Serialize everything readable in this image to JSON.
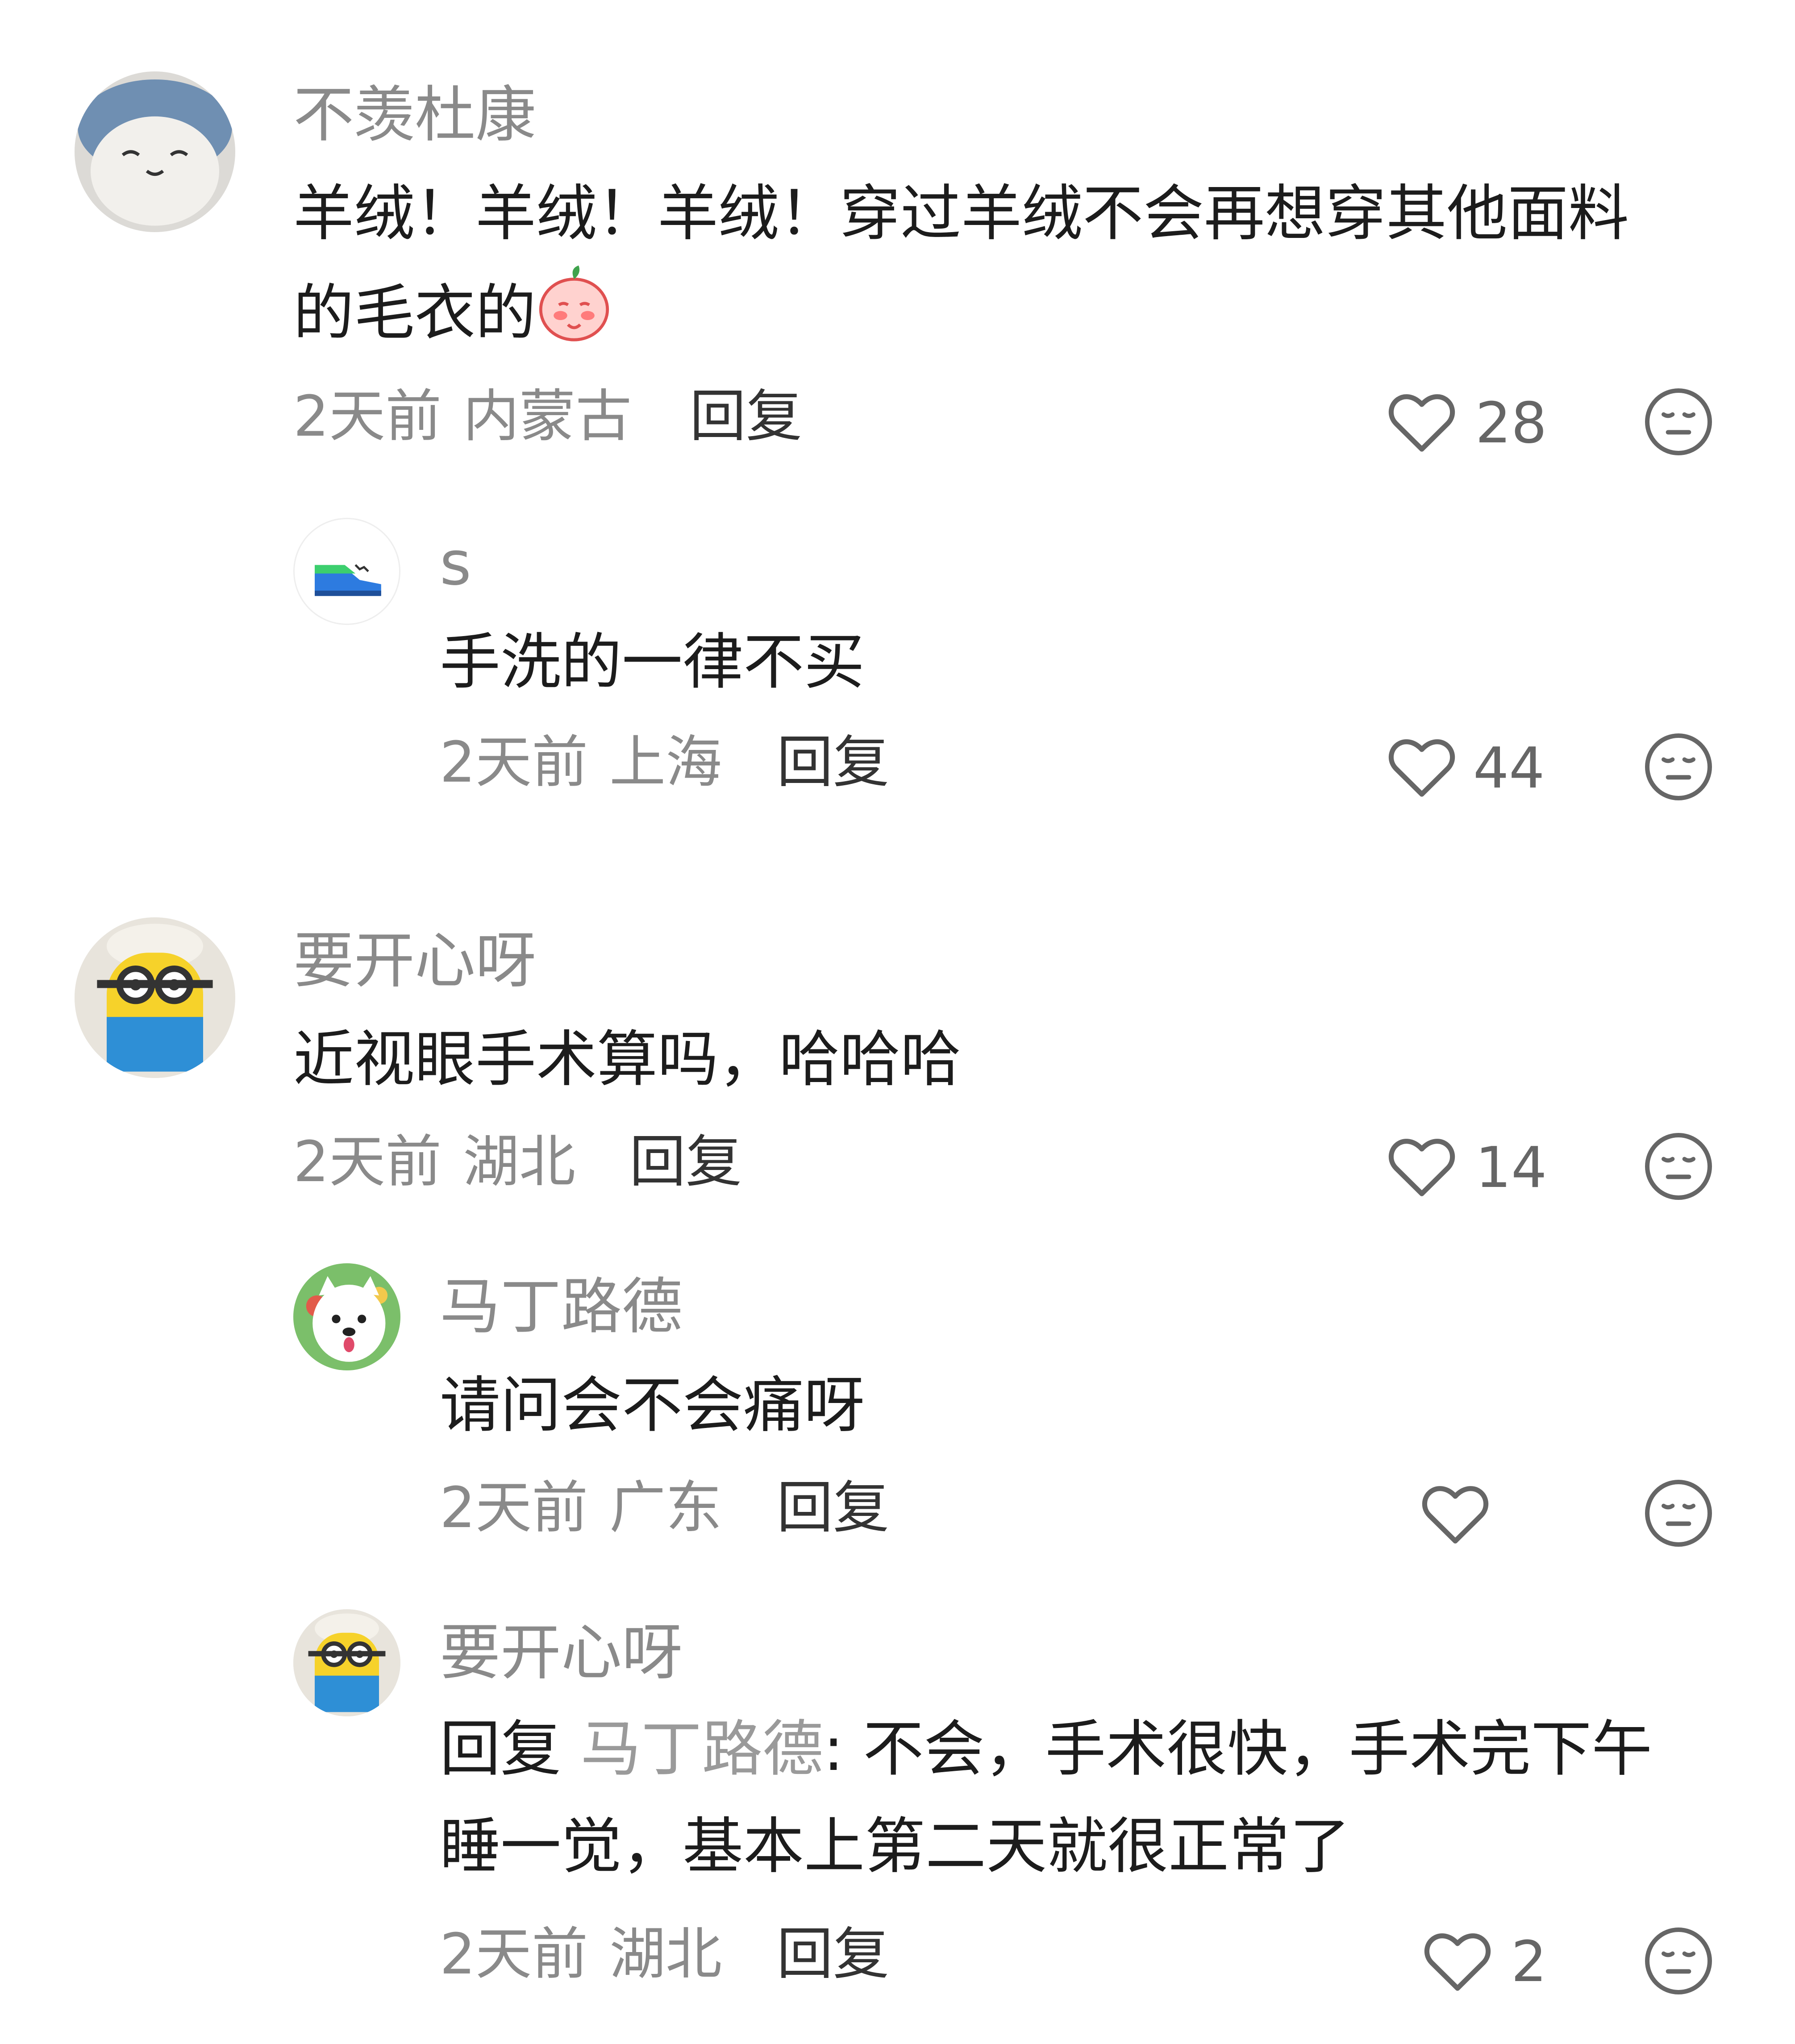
{
  "comments": [
    {
      "username": "不羡杜康",
      "content_line1": "羊绒！羊绒！羊绒！穿过羊绒不会再想穿其他面料",
      "content_line2": "的毛衣的",
      "time": "2天前",
      "location": "内蒙古",
      "reply_label": "回复",
      "likes": "28",
      "avatar_icon": "fluffy-plush-avatar"
    },
    {
      "username": "s",
      "content_line1": "手洗的一律不买",
      "time": "2天前",
      "location": "上海",
      "reply_label": "回复",
      "likes": "44",
      "avatar_icon": "sneaker-avatar"
    },
    {
      "username": "要开心呀",
      "content_line1": "近视眼手术算吗，哈哈哈",
      "time": "2天前",
      "location": "湖北",
      "reply_label": "回复",
      "likes": "14",
      "avatar_icon": "minion-avatar"
    },
    {
      "username": "马丁路德",
      "content_line1": "请问会不会痛呀",
      "time": "2天前",
      "location": "广东",
      "reply_label": "回复",
      "likes": "",
      "avatar_icon": "white-dog-avatar"
    },
    {
      "username": "要开心呀",
      "reply_prefix": "回复 ",
      "mention": "马丁路德",
      "content_line1_rest": ": 不会，手术很快，手术完下午",
      "content_line2": "睡一觉，基本上第二天就很正常了",
      "time": "2天前",
      "location": "湖北",
      "reply_label": "回复",
      "likes": "2",
      "avatar_icon": "minion-avatar"
    }
  ],
  "icons": {
    "like": "heart-outline-icon",
    "dislike": "neutral-face-icon"
  },
  "colors": {
    "username": "#8a8a8a",
    "content": "#1c1c1c",
    "meta": "#8a8a8a",
    "icon": "#666666"
  }
}
